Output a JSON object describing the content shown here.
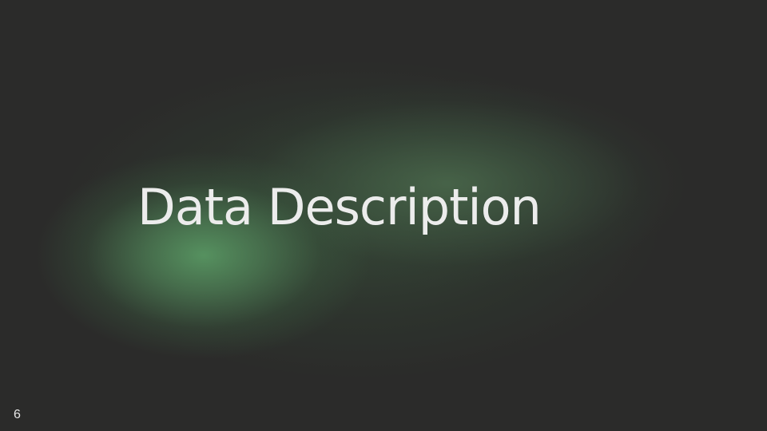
{
  "slide": {
    "title": "Data Description",
    "number": "6"
  },
  "colors": {
    "background": "#2b2b2a",
    "glow": "#5a9662",
    "text": "#ececec"
  }
}
